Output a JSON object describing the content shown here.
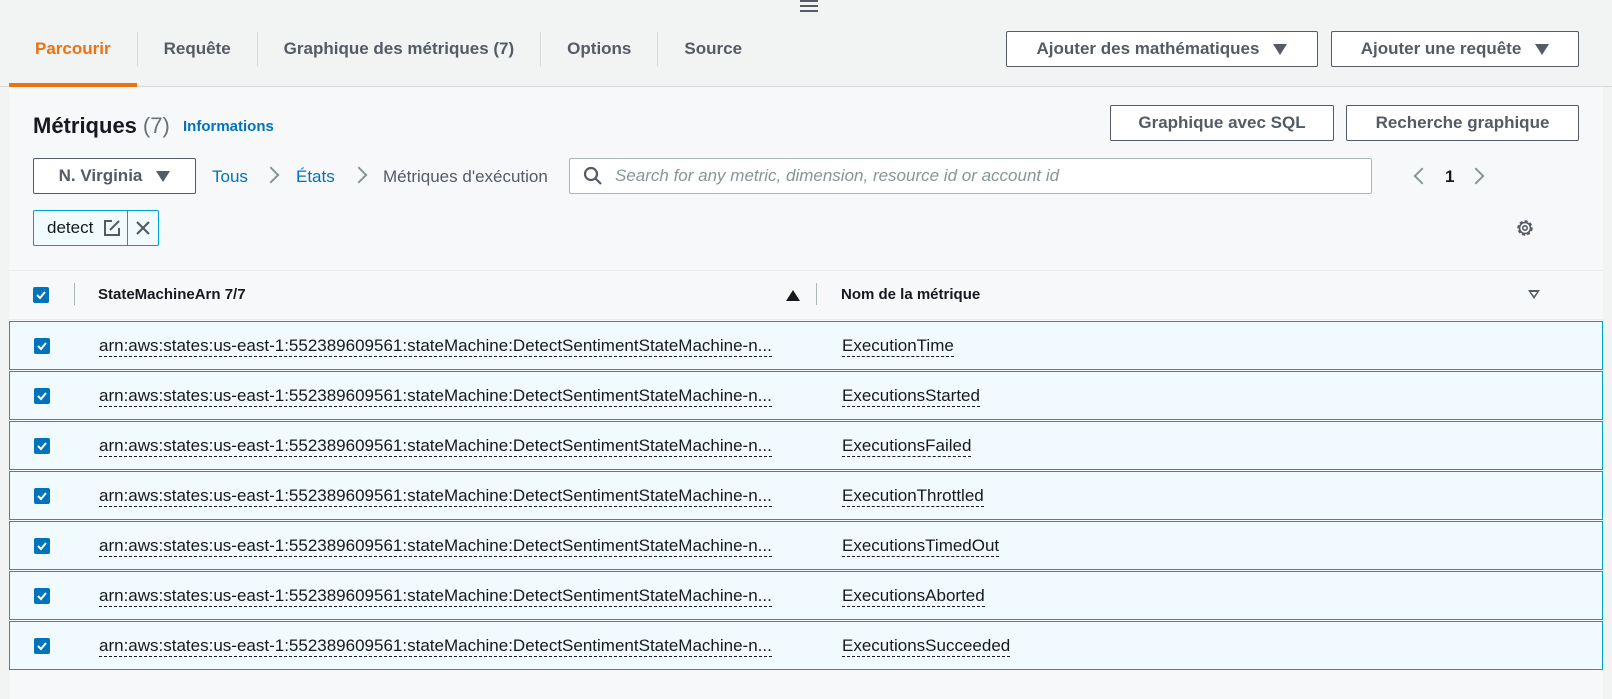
{
  "tabs": [
    {
      "label": "Parcourir",
      "active": true
    },
    {
      "label": "Requête",
      "active": false
    },
    {
      "label": "Graphique des métriques (7)",
      "active": false
    },
    {
      "label": "Options",
      "active": false
    },
    {
      "label": "Source",
      "active": false
    }
  ],
  "toolbar": {
    "add_math_label": "Ajouter des mathématiques",
    "add_query_label": "Ajouter une requête"
  },
  "metrics": {
    "title": "Métriques",
    "count": "(7)",
    "info_link": "Informations",
    "sql_button": "Graphique avec SQL",
    "search_graph_button": "Recherche graphique",
    "region": "N. Virginia",
    "breadcrumb": [
      "Tous",
      "États",
      "Métriques d'exécution"
    ],
    "search_placeholder": "Search for any metric, dimension, resource id or account id",
    "page": "1",
    "filter_token": "detect"
  },
  "table": {
    "col1": "StateMachineArn 7/7",
    "col2": "Nom de la métrique",
    "rows": [
      {
        "arn": "arn:aws:states:us-east-1:552389609561:stateMachine:DetectSentimentStateMachine-n...",
        "metric": "ExecutionTime"
      },
      {
        "arn": "arn:aws:states:us-east-1:552389609561:stateMachine:DetectSentimentStateMachine-n...",
        "metric": "ExecutionsStarted"
      },
      {
        "arn": "arn:aws:states:us-east-1:552389609561:stateMachine:DetectSentimentStateMachine-n...",
        "metric": "ExecutionsFailed"
      },
      {
        "arn": "arn:aws:states:us-east-1:552389609561:stateMachine:DetectSentimentStateMachine-n...",
        "metric": "ExecutionThrottled"
      },
      {
        "arn": "arn:aws:states:us-east-1:552389609561:stateMachine:DetectSentimentStateMachine-n...",
        "metric": "ExecutionsTimedOut"
      },
      {
        "arn": "arn:aws:states:us-east-1:552389609561:stateMachine:DetectSentimentStateMachine-n...",
        "metric": "ExecutionsAborted"
      },
      {
        "arn": "arn:aws:states:us-east-1:552389609561:stateMachine:DetectSentimentStateMachine-n...",
        "metric": "ExecutionsSucceeded"
      }
    ]
  },
  "colors": {
    "accent": "#ec7211",
    "link": "#0073bb",
    "selected_row": "#f1faff",
    "selected_border": "#00a1c9"
  }
}
